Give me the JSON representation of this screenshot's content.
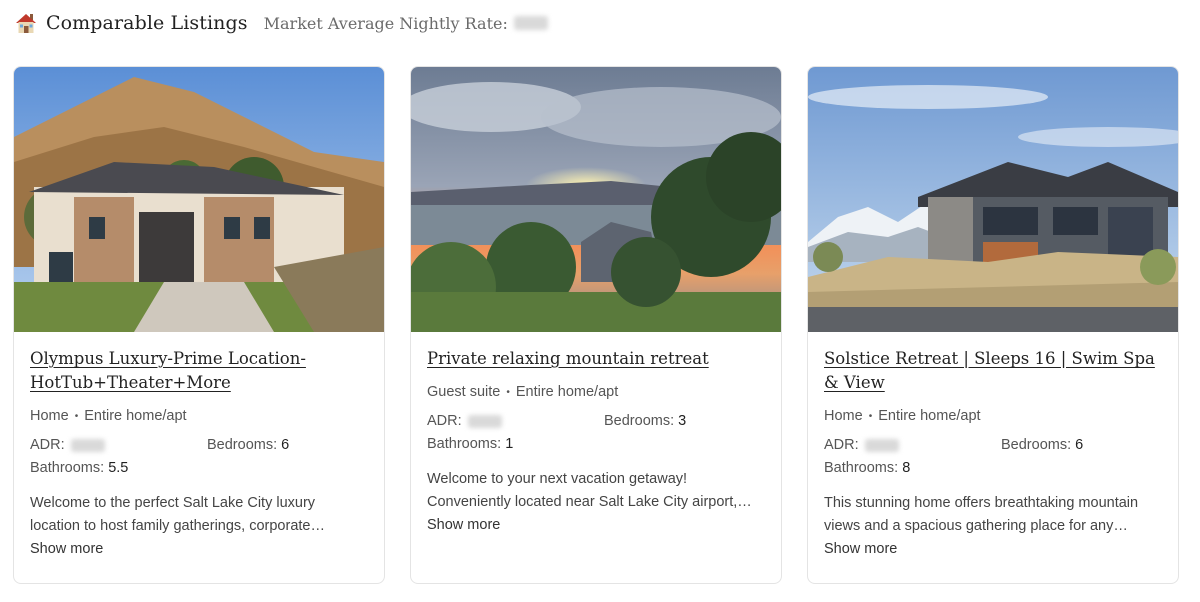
{
  "header": {
    "icon": "house-icon",
    "title": "Comparable Listings",
    "market_label": "Market Average Nightly Rate:"
  },
  "listings": [
    {
      "title": "Olympus Luxury-Prime Location-HotTub+Theater+More",
      "property_type": "Home",
      "room_type": "Entire home/apt",
      "adr_label": "ADR:",
      "bedrooms_label": "Bedrooms:",
      "bedrooms": "6",
      "bathrooms_label": "Bathrooms:",
      "bathrooms": "5.5",
      "description": "Welcome to the perfect Salt Lake City luxury location to host family gatherings, corporate…",
      "show_more": "Show more"
    },
    {
      "title": "Private relaxing mountain retreat",
      "property_type": "Guest suite",
      "room_type": "Entire home/apt",
      "adr_label": "ADR:",
      "bedrooms_label": "Bedrooms:",
      "bedrooms": "3",
      "bathrooms_label": "Bathrooms:",
      "bathrooms": "1",
      "description": "Welcome to your next vacation getaway! Conveniently located near Salt Lake City airport,…",
      "show_more": "Show more"
    },
    {
      "title": "Solstice Retreat | Sleeps 16 | Swim Spa & View",
      "property_type": "Home",
      "room_type": "Entire home/apt",
      "adr_label": "ADR:",
      "bedrooms_label": "Bedrooms:",
      "bedrooms": "6",
      "bathrooms_label": "Bathrooms:",
      "bathrooms": "8",
      "description": "This stunning home offers breathtaking mountain views and a spacious gathering place for any…",
      "show_more": "Show more"
    }
  ],
  "colors": {
    "text": "#222222",
    "muted": "#555555",
    "border": "#e4e4e4",
    "blurred_value": "#d9d9d9"
  }
}
